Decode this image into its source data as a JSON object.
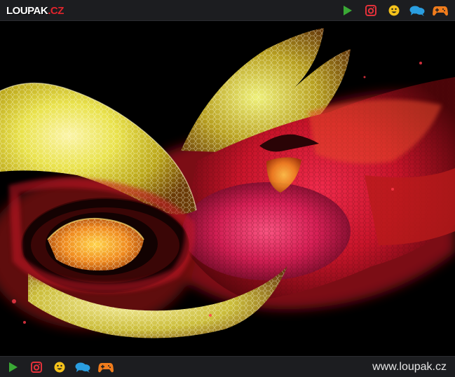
{
  "header": {
    "logo": {
      "main": "LOUPAK",
      "dot": ".",
      "tld": "CZ"
    },
    "icons": [
      {
        "name": "play-icon",
        "color": "#3aa935"
      },
      {
        "name": "instagram-icon",
        "color": "#e2313a"
      },
      {
        "name": "smiley-icon",
        "color": "#f4c21b"
      },
      {
        "name": "chat-icon",
        "color": "#2a9ee0"
      },
      {
        "name": "gamepad-icon",
        "color": "#f07c1c"
      }
    ]
  },
  "photo": {
    "subject": "micro-photo",
    "colors": {
      "background": "#000000",
      "yellow": "#f2e24a",
      "orange": "#f08a1e",
      "red": "#d81e2a",
      "magenta": "#d8205a"
    }
  },
  "footer": {
    "icons": [
      {
        "name": "play-icon",
        "color": "#3aa935"
      },
      {
        "name": "instagram-icon",
        "color": "#e2313a"
      },
      {
        "name": "smiley-icon",
        "color": "#f4c21b"
      },
      {
        "name": "chat-icon",
        "color": "#2a9ee0"
      },
      {
        "name": "gamepad-icon",
        "color": "#f07c1c"
      }
    ],
    "url": "www.loupak.cz"
  }
}
